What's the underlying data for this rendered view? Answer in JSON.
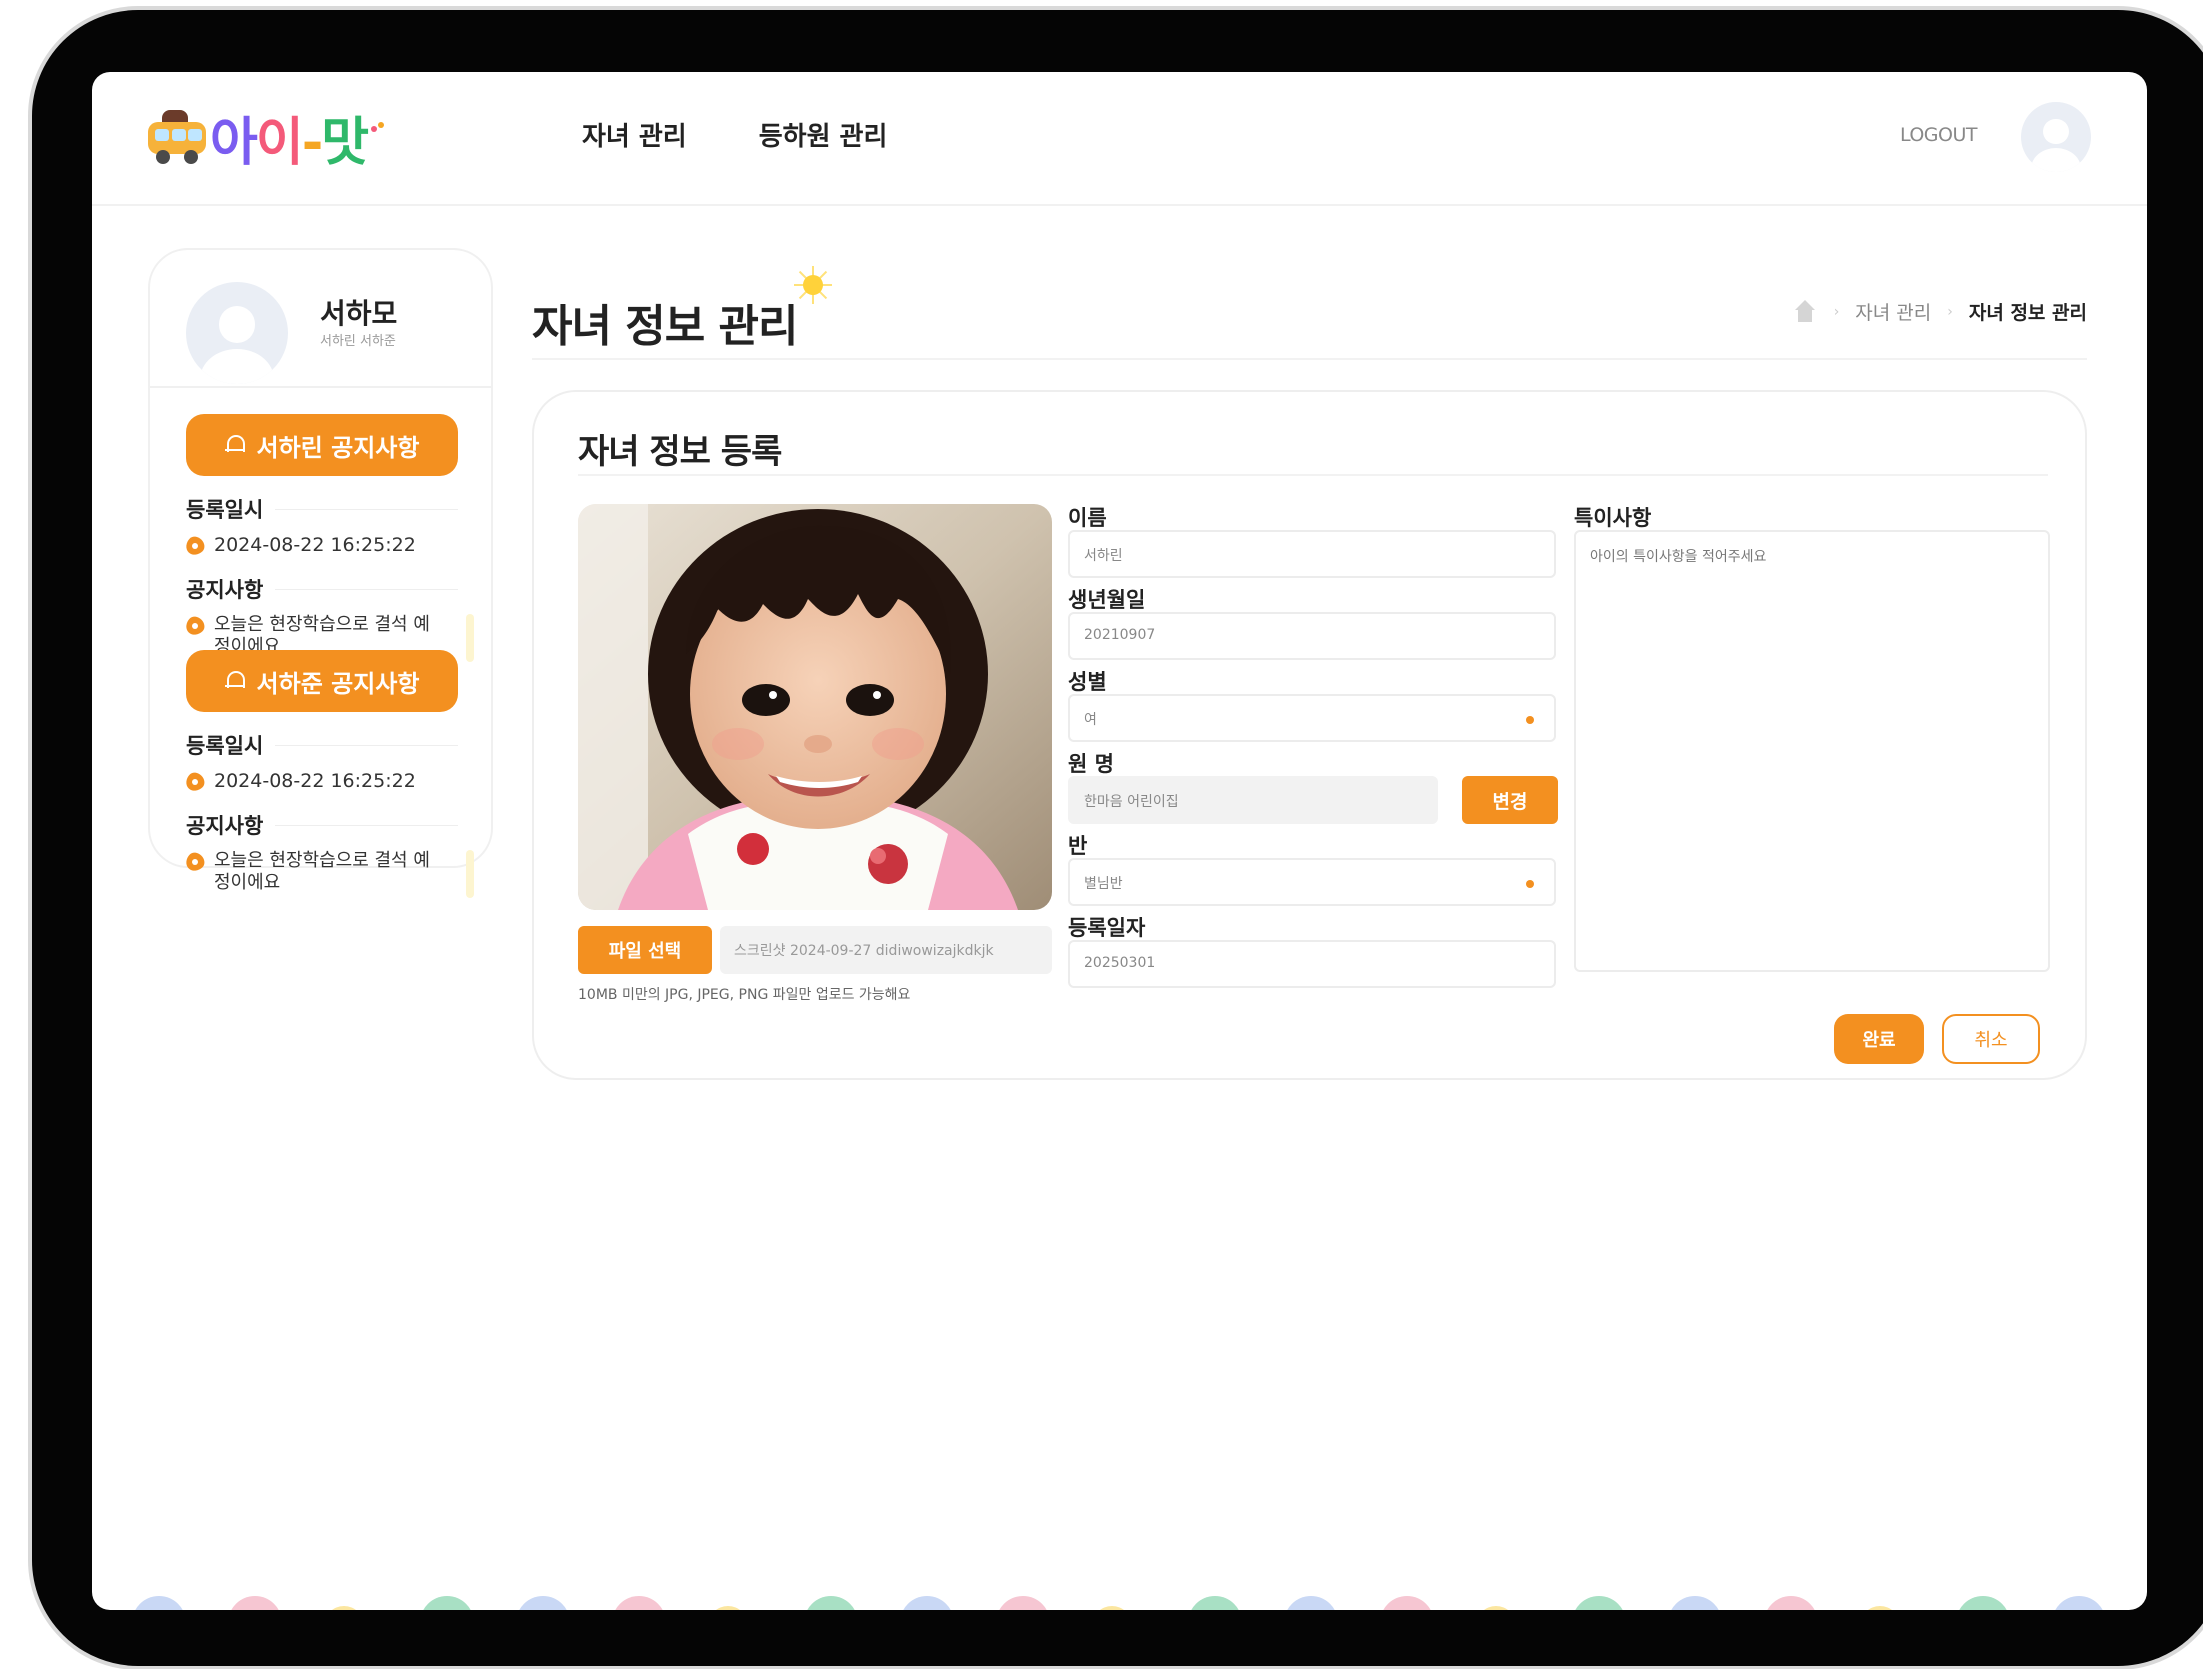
{
  "header": {
    "logo_alt": "아이-맛",
    "logo_parts": [
      "아",
      "이",
      "-",
      "맛"
    ],
    "nav": [
      {
        "label": "자녀 관리"
      },
      {
        "label": "등하원 관리"
      }
    ],
    "logout_label": "LOGOUT"
  },
  "sidebar": {
    "profile": {
      "name": "서하모",
      "children": "서하린 서하준"
    },
    "notices": [
      {
        "button_label": "서하린 공지사항",
        "date_label": "등록일시",
        "date_value": "2024-08-22 16:25:22",
        "notice_label": "공지사항",
        "notice_text": "오늘은 현장학습으로 결석 예정이에요"
      },
      {
        "button_label": "서하준 공지사항",
        "date_label": "등록일시",
        "date_value": "2024-08-22 16:25:22",
        "notice_label": "공지사항",
        "notice_text": "오늘은 현장학습으로 결석 예정이에요"
      }
    ]
  },
  "main": {
    "page_title": "자녀 정보 관리",
    "breadcrumb": [
      "자녀 관리",
      "자녀 정보 관리"
    ]
  },
  "form": {
    "card_title": "자녀 정보 등록",
    "file_button_label": "파일 선택",
    "file_name": "스크린샷 2024-09-27 didiwowizajkdkjk",
    "file_hint": "10MB 미만의 JPG, JPEG, PNG 파일만 업로드 가능해요",
    "fields": {
      "name": {
        "label": "이름",
        "value": "서하린"
      },
      "birth": {
        "label": "생년월일",
        "value": "20210907"
      },
      "gender": {
        "label": "성별",
        "value": "여"
      },
      "kindergarten": {
        "label": "원 명",
        "value": "한마음 어린이집",
        "button_label": "변경"
      },
      "class": {
        "label": "반",
        "value": "별님반"
      },
      "reg_date": {
        "label": "등록일자",
        "value": "20250301"
      },
      "notes": {
        "label": "특이사항",
        "placeholder": "아이의 특이사항을 적어주세요"
      }
    },
    "done_label": "완료",
    "cancel_label": "취소"
  },
  "colors": {
    "accent": "#f39020",
    "frame": "#050505"
  }
}
